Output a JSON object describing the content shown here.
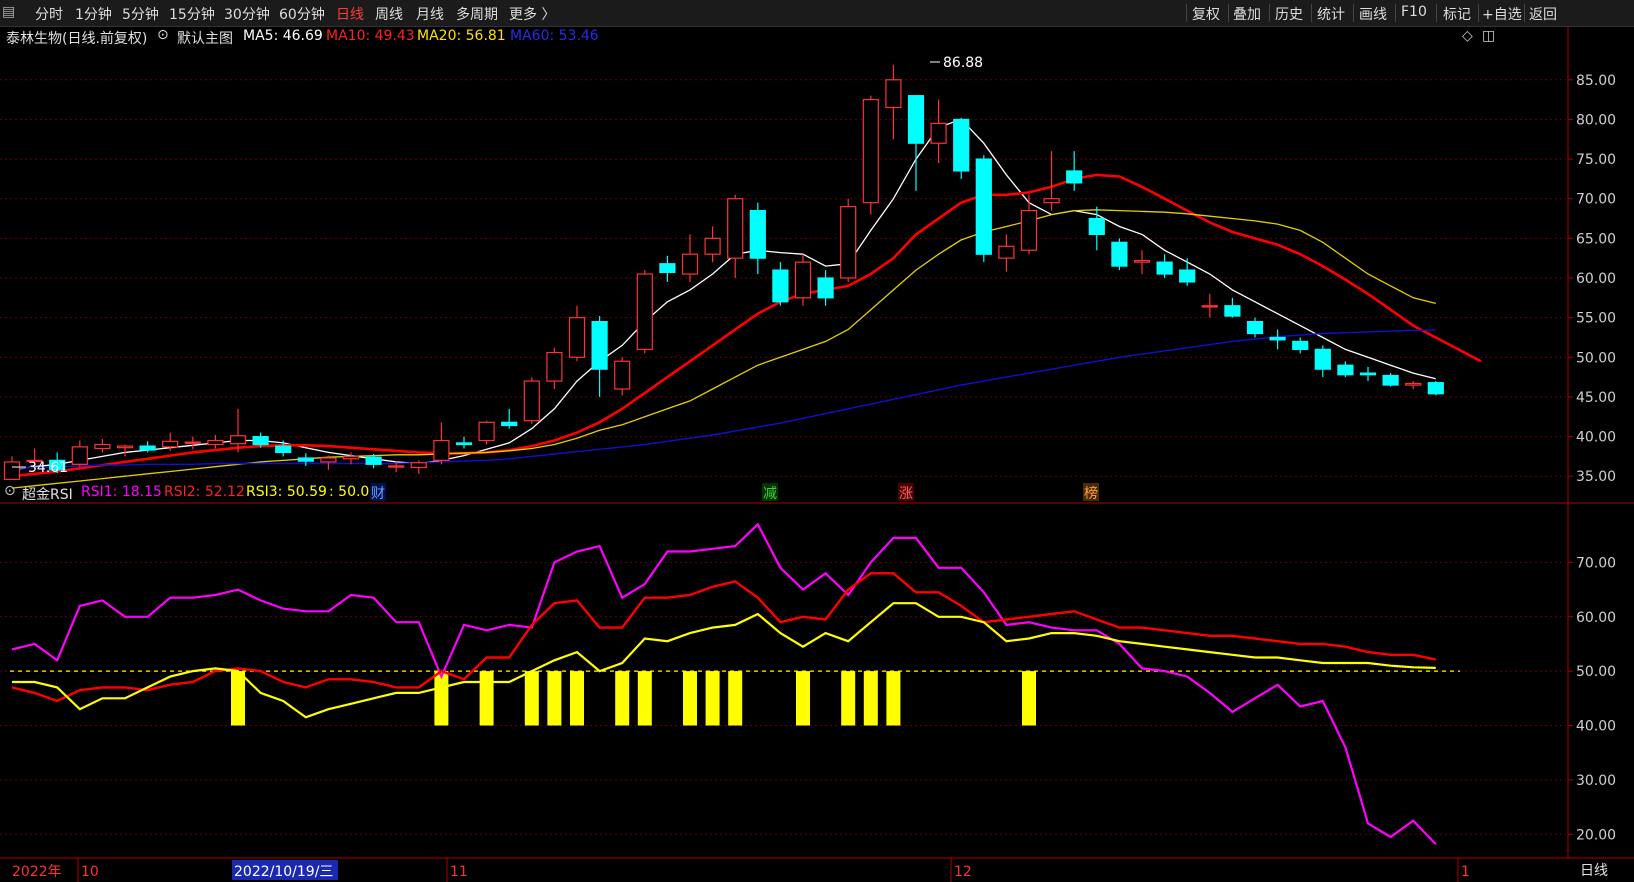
{
  "toolbar": {
    "periods": [
      "分时",
      "1分钟",
      "5分钟",
      "15分钟",
      "30分钟",
      "60分钟",
      "日线",
      "周线",
      "月线",
      "多周期",
      "更多 〉"
    ],
    "active_period": "日线",
    "actions": [
      "复权",
      "叠加",
      "历史",
      "统计",
      "画线",
      "F10",
      "标记",
      "+自选",
      "返回"
    ]
  },
  "main_header": {
    "stock": "泰林生物(日线.前复权)",
    "template": "默认主图",
    "ma5": "MA5: 46.69",
    "ma10": "MA10: 49.43",
    "ma20": "MA20: 56.81",
    "ma60": "MA60: 53.46"
  },
  "sub_header": {
    "name": "超金RSI",
    "rsi1": "RSI1: 18.15",
    "rsi2": "RSI2: 52.12",
    "rsi3": "RSI3: 50.59",
    "ref": ": 50.00"
  },
  "annotations": {
    "high_label": "86.88",
    "low_label": "34.61",
    "markers": [
      "财",
      "减",
      "涨",
      "榜"
    ]
  },
  "date_axis": {
    "labels": [
      "2022年",
      "10",
      "2022/10/19/三",
      "11",
      "12",
      "1"
    ],
    "period_tab": "日线"
  },
  "colors": {
    "up": "#ff3232",
    "down": "#00ffff",
    "ma5": "#ffffff",
    "ma10": "#ff0000",
    "ma20": "#e0d000",
    "ma60": "#1010d0",
    "rsi1": "#ff00ff",
    "rsi2": "#ff0000",
    "rsi3": "#ffff00",
    "grid": "#6a0000"
  },
  "chart_data": [
    {
      "type": "candlestick",
      "title": "泰林生物(日线.前复权)",
      "y_ticks": [
        "85.00",
        "80.00",
        "75.00",
        "70.00",
        "65.00",
        "60.00",
        "55.00",
        "50.00",
        "45.00",
        "40.00",
        "35.00"
      ],
      "ylim": [
        32,
        88
      ],
      "candles": [
        {
          "o": 34.6,
          "h": 37.5,
          "l": 34.61,
          "c": 36.8
        },
        {
          "o": 36.9,
          "h": 38.5,
          "l": 36.0,
          "c": 37.0
        },
        {
          "o": 37.0,
          "h": 38.0,
          "l": 35.4,
          "c": 35.8
        },
        {
          "o": 36.5,
          "h": 39.5,
          "l": 36.2,
          "c": 38.7
        },
        {
          "o": 38.5,
          "h": 39.7,
          "l": 38.0,
          "c": 39.0
        },
        {
          "o": 38.6,
          "h": 39.0,
          "l": 37.5,
          "c": 38.8
        },
        {
          "o": 38.8,
          "h": 39.4,
          "l": 38.0,
          "c": 38.3
        },
        {
          "o": 38.7,
          "h": 40.5,
          "l": 38.2,
          "c": 39.4
        },
        {
          "o": 39.2,
          "h": 40.0,
          "l": 38.4,
          "c": 39.3
        },
        {
          "o": 39.0,
          "h": 40.2,
          "l": 38.5,
          "c": 39.5
        },
        {
          "o": 39.1,
          "h": 43.5,
          "l": 38.0,
          "c": 40.1
        },
        {
          "o": 40.0,
          "h": 40.5,
          "l": 38.6,
          "c": 39.0
        },
        {
          "o": 38.8,
          "h": 39.5,
          "l": 37.5,
          "c": 38.0
        },
        {
          "o": 37.3,
          "h": 37.9,
          "l": 36.3,
          "c": 36.9
        },
        {
          "o": 36.8,
          "h": 37.6,
          "l": 35.8,
          "c": 37.3
        },
        {
          "o": 37.2,
          "h": 38.0,
          "l": 36.5,
          "c": 37.5
        },
        {
          "o": 37.4,
          "h": 37.8,
          "l": 36.0,
          "c": 36.5
        },
        {
          "o": 36.3,
          "h": 36.9,
          "l": 35.5,
          "c": 36.3
        },
        {
          "o": 36.1,
          "h": 37.0,
          "l": 35.3,
          "c": 36.7
        },
        {
          "o": 37.0,
          "h": 41.8,
          "l": 36.5,
          "c": 39.5
        },
        {
          "o": 39.2,
          "h": 40.0,
          "l": 38.5,
          "c": 39.0
        },
        {
          "o": 39.5,
          "h": 42.0,
          "l": 39.0,
          "c": 41.8
        },
        {
          "o": 41.8,
          "h": 43.5,
          "l": 41.0,
          "c": 41.4
        },
        {
          "o": 42.0,
          "h": 47.5,
          "l": 41.6,
          "c": 47.0
        },
        {
          "o": 47.0,
          "h": 51.2,
          "l": 46.0,
          "c": 50.6
        },
        {
          "o": 50.0,
          "h": 56.5,
          "l": 49.5,
          "c": 55.0
        },
        {
          "o": 54.5,
          "h": 55.2,
          "l": 45.0,
          "c": 48.5
        },
        {
          "o": 46.0,
          "h": 50.0,
          "l": 45.2,
          "c": 49.5
        },
        {
          "o": 51.0,
          "h": 61.0,
          "l": 50.5,
          "c": 60.5
        },
        {
          "o": 61.8,
          "h": 62.8,
          "l": 59.5,
          "c": 60.7
        },
        {
          "o": 60.5,
          "h": 65.5,
          "l": 59.5,
          "c": 63.0
        },
        {
          "o": 63.0,
          "h": 66.5,
          "l": 62.0,
          "c": 65.0
        },
        {
          "o": 62.5,
          "h": 70.5,
          "l": 60.0,
          "c": 70.0
        },
        {
          "o": 68.5,
          "h": 69.5,
          "l": 60.5,
          "c": 62.5
        },
        {
          "o": 61.0,
          "h": 62.0,
          "l": 56.5,
          "c": 57.0
        },
        {
          "o": 57.5,
          "h": 63.0,
          "l": 56.5,
          "c": 62.0
        },
        {
          "o": 60.0,
          "h": 61.0,
          "l": 56.5,
          "c": 57.5
        },
        {
          "o": 60.0,
          "h": 70.0,
          "l": 59.5,
          "c": 69.0
        },
        {
          "o": 69.5,
          "h": 83.0,
          "l": 68.0,
          "c": 82.5
        },
        {
          "o": 81.5,
          "h": 86.88,
          "l": 77.5,
          "c": 85.0
        },
        {
          "o": 83.0,
          "h": 83.0,
          "l": 71.0,
          "c": 77.0
        },
        {
          "o": 77.0,
          "h": 82.5,
          "l": 74.5,
          "c": 79.5
        },
        {
          "o": 80.0,
          "h": 80.2,
          "l": 72.5,
          "c": 73.5
        },
        {
          "o": 75.0,
          "h": 75.5,
          "l": 62.0,
          "c": 63.0
        },
        {
          "o": 62.5,
          "h": 65.5,
          "l": 60.8,
          "c": 64.0
        },
        {
          "o": 63.5,
          "h": 70.5,
          "l": 63.0,
          "c": 68.5
        },
        {
          "o": 69.5,
          "h": 76.0,
          "l": 68.5,
          "c": 70.0
        },
        {
          "o": 73.5,
          "h": 76.0,
          "l": 71.0,
          "c": 72.0
        },
        {
          "o": 67.5,
          "h": 69.0,
          "l": 63.5,
          "c": 65.5
        },
        {
          "o": 64.5,
          "h": 65.0,
          "l": 61.0,
          "c": 61.5
        },
        {
          "o": 62.0,
          "h": 63.5,
          "l": 60.5,
          "c": 62.2
        },
        {
          "o": 62.0,
          "h": 63.0,
          "l": 60.0,
          "c": 60.5
        },
        {
          "o": 61.0,
          "h": 62.5,
          "l": 59.0,
          "c": 59.5
        },
        {
          "o": 56.5,
          "h": 58.0,
          "l": 55.0,
          "c": 56.5
        },
        {
          "o": 56.5,
          "h": 57.5,
          "l": 55.0,
          "c": 55.2
        },
        {
          "o": 54.5,
          "h": 55.0,
          "l": 52.5,
          "c": 53.0
        },
        {
          "o": 52.5,
          "h": 53.5,
          "l": 51.0,
          "c": 52.2
        },
        {
          "o": 52.0,
          "h": 52.5,
          "l": 50.5,
          "c": 51.0
        },
        {
          "o": 51.0,
          "h": 51.5,
          "l": 47.5,
          "c": 48.5
        },
        {
          "o": 49.0,
          "h": 49.5,
          "l": 47.5,
          "c": 47.8
        },
        {
          "o": 48.0,
          "h": 48.8,
          "l": 47.0,
          "c": 47.8
        },
        {
          "o": 47.7,
          "h": 48.0,
          "l": 46.3,
          "c": 46.5
        },
        {
          "o": 46.5,
          "h": 47.0,
          "l": 46.0,
          "c": 46.7
        },
        {
          "o": 46.8,
          "h": 47.0,
          "l": 45.2,
          "c": 45.4
        }
      ],
      "series": [
        {
          "name": "MA5",
          "values": [
            35.8,
            36.2,
            36.5,
            37.0,
            37.5,
            38.0,
            38.3,
            38.6,
            38.9,
            39.2,
            39.5,
            39.5,
            39.2,
            38.6,
            38.0,
            37.6,
            37.2,
            36.8,
            36.6,
            37.0,
            37.6,
            38.4,
            39.2,
            41.0,
            43.5,
            47.0,
            49.5,
            51.5,
            54.5,
            57.0,
            58.5,
            60.5,
            63.0,
            63.5,
            63.2,
            63.0,
            61.5,
            61.8,
            66.0,
            70.0,
            75.0,
            79.0,
            80.0,
            77.0,
            73.0,
            69.5,
            68.0,
            68.5,
            68.0,
            66.5,
            65.5,
            63.5,
            62.0,
            60.5,
            58.5,
            57.0,
            55.5,
            54.0,
            52.5,
            51.0,
            50.0,
            49.0,
            48.0,
            47.3
          ]
        },
        {
          "name": "MA10",
          "values": [
            35.0,
            35.3,
            35.6,
            36.0,
            36.4,
            36.8,
            37.2,
            37.6,
            38.0,
            38.3,
            38.6,
            38.8,
            38.9,
            38.9,
            38.8,
            38.6,
            38.4,
            38.2,
            38.0,
            37.9,
            37.9,
            38.0,
            38.3,
            38.8,
            39.5,
            40.5,
            41.8,
            43.5,
            45.5,
            47.5,
            49.5,
            51.5,
            53.5,
            55.5,
            57.0,
            58.0,
            58.5,
            59.0,
            60.5,
            62.5,
            65.5,
            67.5,
            69.5,
            70.5,
            70.5,
            70.8,
            71.5,
            72.5,
            73.0,
            72.8,
            71.5,
            70.0,
            68.5,
            67.0,
            65.8,
            65.0,
            64.2,
            63.0,
            61.5,
            59.8,
            58.0,
            56.0,
            54.0,
            52.5,
            51.0,
            49.5
          ]
        },
        {
          "name": "MA20",
          "values": [
            33.5,
            33.8,
            34.1,
            34.4,
            34.7,
            35.0,
            35.3,
            35.6,
            35.9,
            36.2,
            36.5,
            36.8,
            37.0,
            37.2,
            37.4,
            37.5,
            37.6,
            37.7,
            37.7,
            37.8,
            37.9,
            38.0,
            38.2,
            38.5,
            39.0,
            39.8,
            40.8,
            41.5,
            42.5,
            43.5,
            44.5,
            46.0,
            47.5,
            49.0,
            50.0,
            51.0,
            52.0,
            53.5,
            56.0,
            58.5,
            61.0,
            63.0,
            64.8,
            65.8,
            66.5,
            67.2,
            68.0,
            68.5,
            68.6,
            68.5,
            68.4,
            68.3,
            68.1,
            67.8,
            67.5,
            67.2,
            66.8,
            66.0,
            64.5,
            62.5,
            60.5,
            59.0,
            57.5,
            56.8
          ]
        },
        {
          "name": "MA60",
          "values": [
            36.0,
            36.1,
            36.2,
            36.3,
            36.4,
            36.4,
            36.5,
            36.5,
            36.5,
            36.6,
            36.6,
            36.6,
            36.6,
            36.6,
            36.6,
            36.6,
            36.6,
            36.6,
            36.7,
            36.8,
            36.9,
            37.0,
            37.2,
            37.5,
            37.8,
            38.1,
            38.4,
            38.7,
            39.0,
            39.4,
            39.8,
            40.2,
            40.7,
            41.2,
            41.7,
            42.3,
            42.9,
            43.5,
            44.1,
            44.7,
            45.3,
            45.9,
            46.5,
            47.0,
            47.5,
            48.0,
            48.5,
            49.0,
            49.5,
            50.0,
            50.4,
            50.8,
            51.2,
            51.6,
            52.0,
            52.3,
            52.6,
            52.8,
            53.0,
            53.1,
            53.2,
            53.3,
            53.4,
            53.46
          ]
        }
      ]
    },
    {
      "type": "line",
      "title": "超金RSI",
      "y_ticks": [
        "70.00",
        "60.00",
        "50.00",
        "40.00",
        "30.00",
        "20.00"
      ],
      "ylim": [
        16,
        80
      ],
      "reference": 50.0,
      "signals": [
        10,
        19,
        21,
        23,
        24,
        25,
        27,
        28,
        30,
        31,
        32,
        35,
        37,
        38,
        39,
        45
      ],
      "series": [
        {
          "name": "RSI1",
          "values": [
            54,
            55,
            52,
            62,
            63,
            60,
            60,
            63.5,
            63.5,
            64,
            65,
            63,
            61.5,
            61,
            61,
            64,
            63.5,
            59,
            59,
            49,
            58.5,
            57.5,
            58.5,
            58,
            70,
            72,
            73,
            63.5,
            66,
            72,
            72,
            72.5,
            73,
            77,
            69,
            65,
            68,
            64,
            70,
            74.5,
            74.5,
            69,
            69,
            64.5,
            58.5,
            59,
            58,
            57.5,
            57.5,
            55,
            50.5,
            50,
            49,
            46,
            42.5,
            45,
            47.5,
            43.5,
            44.5,
            36,
            22,
            19.5,
            22.5,
            18.15
          ]
        },
        {
          "name": "RSI2",
          "values": [
            47,
            46,
            44.5,
            46.5,
            47,
            47,
            46.5,
            47.5,
            48,
            50,
            50.5,
            50,
            48,
            47,
            48.5,
            48.5,
            48,
            47,
            47,
            50,
            48.5,
            52.5,
            52.5,
            58.5,
            62.5,
            63,
            58,
            58,
            63.5,
            63.5,
            64,
            65.5,
            66.5,
            63.5,
            59,
            60,
            59.5,
            65,
            68,
            68,
            64.5,
            64.5,
            62,
            59,
            59.5,
            60,
            60.5,
            61,
            59.5,
            58,
            58,
            57.5,
            57,
            56.5,
            56.5,
            56,
            55.5,
            55,
            55,
            54.5,
            53.5,
            53,
            53,
            52.12
          ]
        },
        {
          "name": "RSI3",
          "values": [
            48,
            48,
            47,
            43,
            45,
            45,
            47,
            49,
            50,
            50.5,
            50,
            46,
            44.5,
            41.5,
            43,
            44,
            45,
            46,
            46,
            47,
            48,
            48,
            48,
            50,
            52,
            53.5,
            50,
            51.5,
            56,
            55.5,
            57,
            58,
            58.5,
            60.5,
            57,
            54.5,
            57,
            55.5,
            59,
            62.5,
            62.5,
            60,
            60,
            59,
            55.5,
            56,
            57,
            57,
            56.5,
            55.5,
            55,
            54.5,
            54,
            53.5,
            53,
            52.5,
            52.5,
            52,
            51.5,
            51.5,
            51.5,
            51,
            50.7,
            50.59
          ]
        }
      ]
    }
  ]
}
